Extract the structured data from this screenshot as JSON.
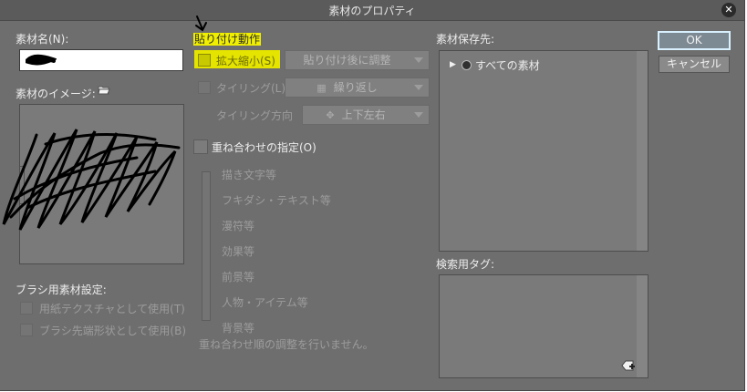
{
  "window": {
    "title": "素材のプロパティ"
  },
  "buttons": {
    "ok": "OK",
    "cancel": "キャンセル"
  },
  "left": {
    "material_name_label": "素材名(N):",
    "material_name_value": "",
    "image_label": "素材のイメージ:",
    "brush_settings_label": "ブラシ用素材設定:",
    "brush_paper_texture": "用紙テクスチャとして使用(T)",
    "brush_tip_shape": "ブラシ先端形状として使用(B)"
  },
  "paste": {
    "section_label": "貼り付け動作",
    "scale_label": "拡大縮小(S)",
    "scale_select": "貼り付け後に調整",
    "tiling_label": "タイリング(L)",
    "tiling_select": "繰り返し",
    "tiling_dir_label": "タイリング方向",
    "tiling_dir_select": "上下左右",
    "overlay_label": "重ね合わせの指定(O)",
    "overlay_items": [
      "描き文字等",
      "フキダシ・テキスト等",
      "漫符等",
      "効果等",
      "前景等",
      "人物・アイテム等",
      "背景等"
    ],
    "overlay_note": "重ね合わせ順の調整を行いません。"
  },
  "save": {
    "label": "素材保存先:",
    "tree_item": "すべての素材",
    "tag_label": "検索用タグ:"
  },
  "icons": {
    "close": "close-icon",
    "folder": "folder-icon",
    "expand": "expand-arrow-icon",
    "material": "material-folder-icon",
    "add_tag": "add-tag-icon"
  }
}
